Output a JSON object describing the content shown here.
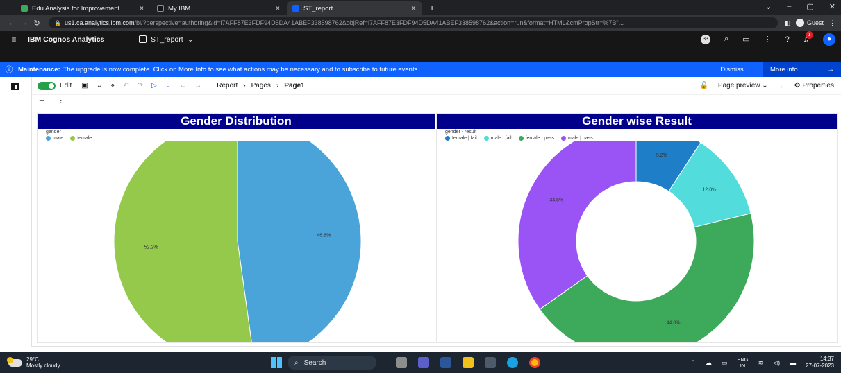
{
  "browser": {
    "tabs": [
      {
        "label": "Edu Analysis for Improvement.",
        "active": false
      },
      {
        "label": "My IBM",
        "active": false
      },
      {
        "label": "ST_report",
        "active": true
      }
    ],
    "close_glyph": "×",
    "new_tab_glyph": "+",
    "url_domain": "us1.ca.analytics.ibm.com",
    "url_path": "/bi/?perspective=authoring&id=i7AFF87E3FDF94D5DA41ABEF338598762&objRef=i7AFF87E3FDF94D5DA41ABEF338598762&action=run&format=HTML&cmPropStr=%7B\"...",
    "profile_label": "Guest"
  },
  "app": {
    "title": "IBM Cognos Analytics",
    "report_tab": "ST_report",
    "presence_count": "33",
    "notification_count": "1"
  },
  "banner": {
    "title": "Maintenance:",
    "message": "The upgrade is now complete. Click on More Info to see what actions may be necessary and to subscribe to future events",
    "dismiss_label": "Dismiss",
    "more_info_label": "More info"
  },
  "toolbar": {
    "edit_label": "Edit",
    "breadcrumb": [
      "Report",
      "Pages",
      "Page1"
    ],
    "page_preview_label": "Page preview",
    "properties_label": "Properties"
  },
  "chart_data": [
    {
      "type": "pie",
      "title": "Gender Distribution",
      "legend_title": "gender",
      "categories": [
        "male",
        "female"
      ],
      "values": [
        47.8,
        52.2
      ],
      "labels": [
        "46.8%",
        "52.2%"
      ],
      "colors": [
        "#4aa4d9",
        "#94c94b"
      ],
      "legend_position": "top-left"
    },
    {
      "type": "pie",
      "subtype": "donut",
      "title": "Gender wise Result",
      "legend_title": "gender - result",
      "categories": [
        "female | fail",
        "male | fail",
        "female | pass",
        "male | pass"
      ],
      "values": [
        9.2,
        12.0,
        44.0,
        34.8
      ],
      "labels": [
        "9.2%",
        "12.0%",
        "44.0%",
        "34.8%"
      ],
      "colors": [
        "#1e7ec8",
        "#52dcdc",
        "#3da95a",
        "#9a53f5"
      ],
      "legend_position": "top-left"
    }
  ],
  "taskbar": {
    "temperature": "29°C",
    "weather": "Mostly cloudy",
    "search_label": "Search",
    "lang_top": "ENG",
    "lang_bottom": "IN",
    "time": "14:37",
    "date": "27-07-2023"
  }
}
